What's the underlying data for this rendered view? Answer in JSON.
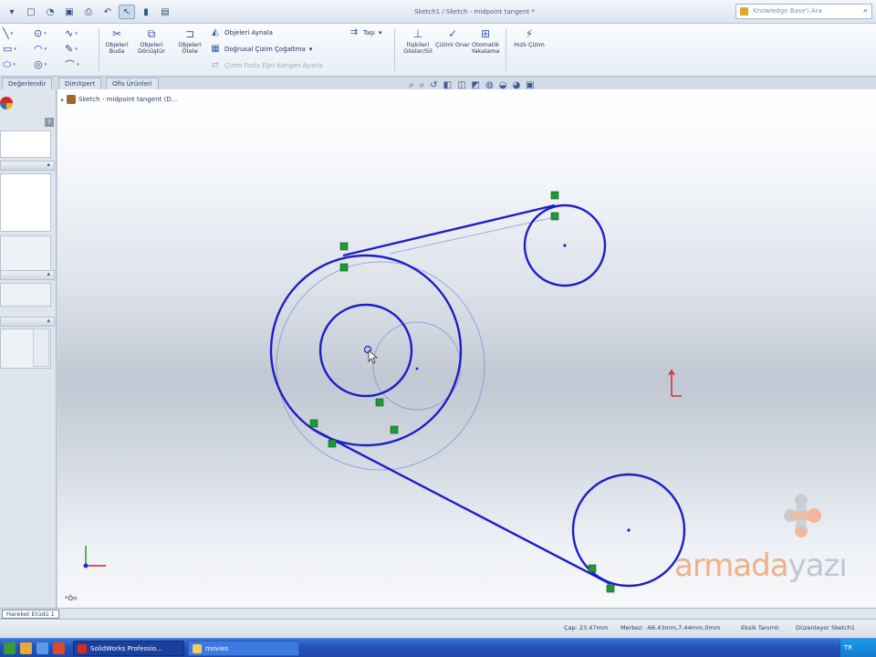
{
  "window": {
    "title": "Sketch1 / Sketch - midpoint tangent *"
  },
  "search": {
    "placeholder": "Knowledge Base'i Ara"
  },
  "quick_access": {
    "icons": [
      "new-doc-icon",
      "open-icon",
      "save-icon",
      "print-icon",
      "undo-icon",
      "select-icon",
      "rebuild-icon",
      "options-icon"
    ]
  },
  "ribbon": {
    "trim": "Objeleri Buda",
    "convert": "Objeleri Dönüştür",
    "offset": "Objeleri Ötele",
    "mirror": "Objeleri Aynala",
    "linear_pattern": "Doğrusal Çizim Çoğaltma",
    "move": "Çizim Fazla Eğri Kengen Ayarla",
    "relations": "İlişkileri Göster/Sil",
    "repair": "Çizimi Onar",
    "snap": "Otomatik Yakalama",
    "rapid": "Hızlı Çizim",
    "tasi": "Taşı"
  },
  "tabs": [
    "Değerlendir",
    "DimXpert",
    "Ofis Ürünleri"
  ],
  "tree": {
    "label": "Sketch - midpoint tangent (D..."
  },
  "headsup_icons": [
    "zoom-fit-icon",
    "zoom-area-icon",
    "previous-view-icon",
    "section-view-icon",
    "view-orientation-icon",
    "display-style-icon",
    "hide-show-icon",
    "edit-appearance-icon",
    "scene-icon",
    "view-settings-icon"
  ],
  "axis": {
    "label": "*Ön"
  },
  "model_tab": "Hareket Etüdü 1",
  "status": {
    "cap": "Çap: 23.47mm",
    "merkez": "Merkez: -66.43mm,7.44mm,0mm",
    "tanim": "Eksik Tanımlı",
    "mode": "Düzenleyor Sketch1"
  },
  "taskbar": {
    "app1": "SolidWorks Professio...",
    "app2": "movies",
    "tray": "TR"
  },
  "watermark": {
    "part1": "armada",
    "part2": "yazı"
  },
  "colors": {
    "sketch_blue": "#1e1ec8",
    "relation_green": "#1f9a36",
    "accent_orange": "#f0a070"
  }
}
